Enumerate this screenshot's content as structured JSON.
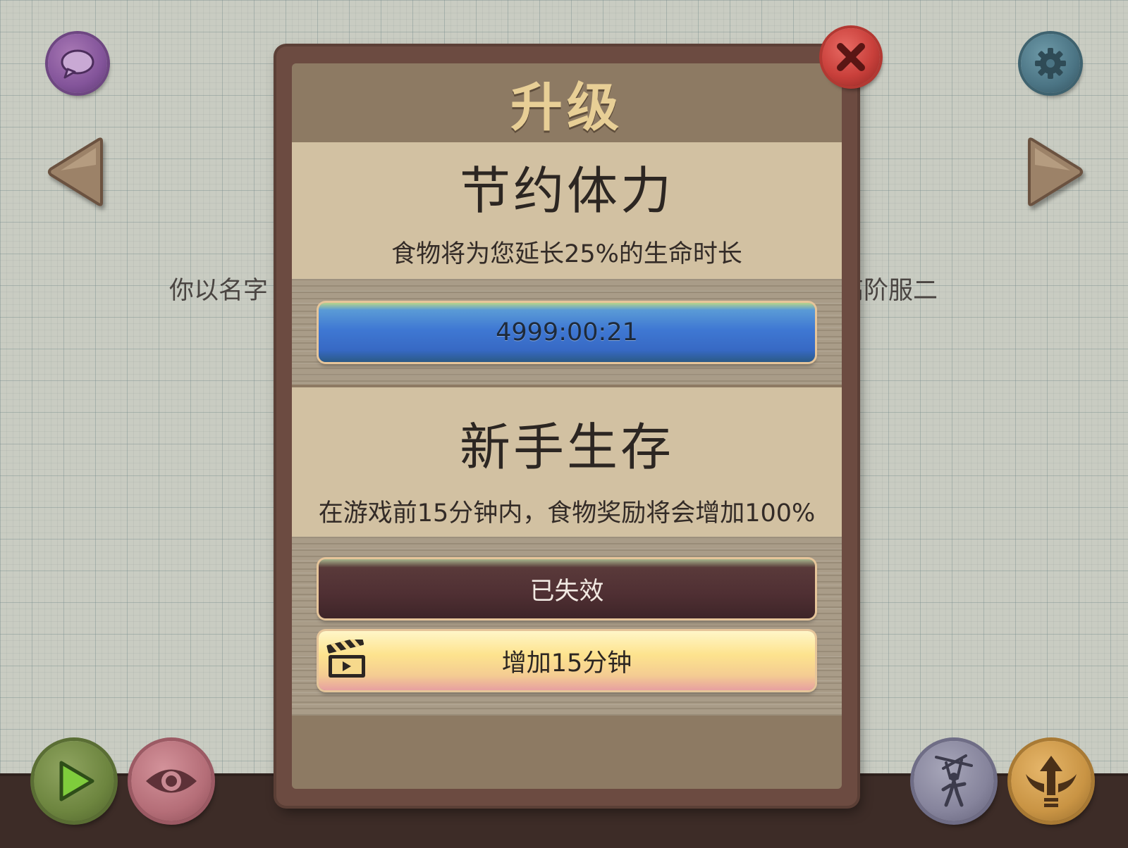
{
  "background": {
    "left_text": "你以名字",
    "right_text": "高阶服二"
  },
  "dialog": {
    "title": "升级",
    "sections": [
      {
        "heading": "节约体力",
        "description": "食物将为您延长25%的生命时长",
        "timer_label": "4999:00:21"
      },
      {
        "heading": "新手生存",
        "description": "在游戏前15分钟内，食物奖励将会增加100%",
        "status_label": "已失效",
        "action_label": "增加15分钟"
      }
    ]
  },
  "icons": {
    "chat": "chat-bubble-icon",
    "settings": "gear-icon",
    "prev": "left-arrow-icon",
    "next": "right-arrow-icon",
    "close": "close-icon",
    "play": "play-icon",
    "view": "eye-icon",
    "puppet": "puppet-icon",
    "upgrade": "winged-arrow-icon",
    "video": "clapperboard-icon"
  },
  "colors": {
    "accent_blue": "#3f78d3",
    "close_red": "#c9403b",
    "title_gold": "#e8cf96"
  }
}
